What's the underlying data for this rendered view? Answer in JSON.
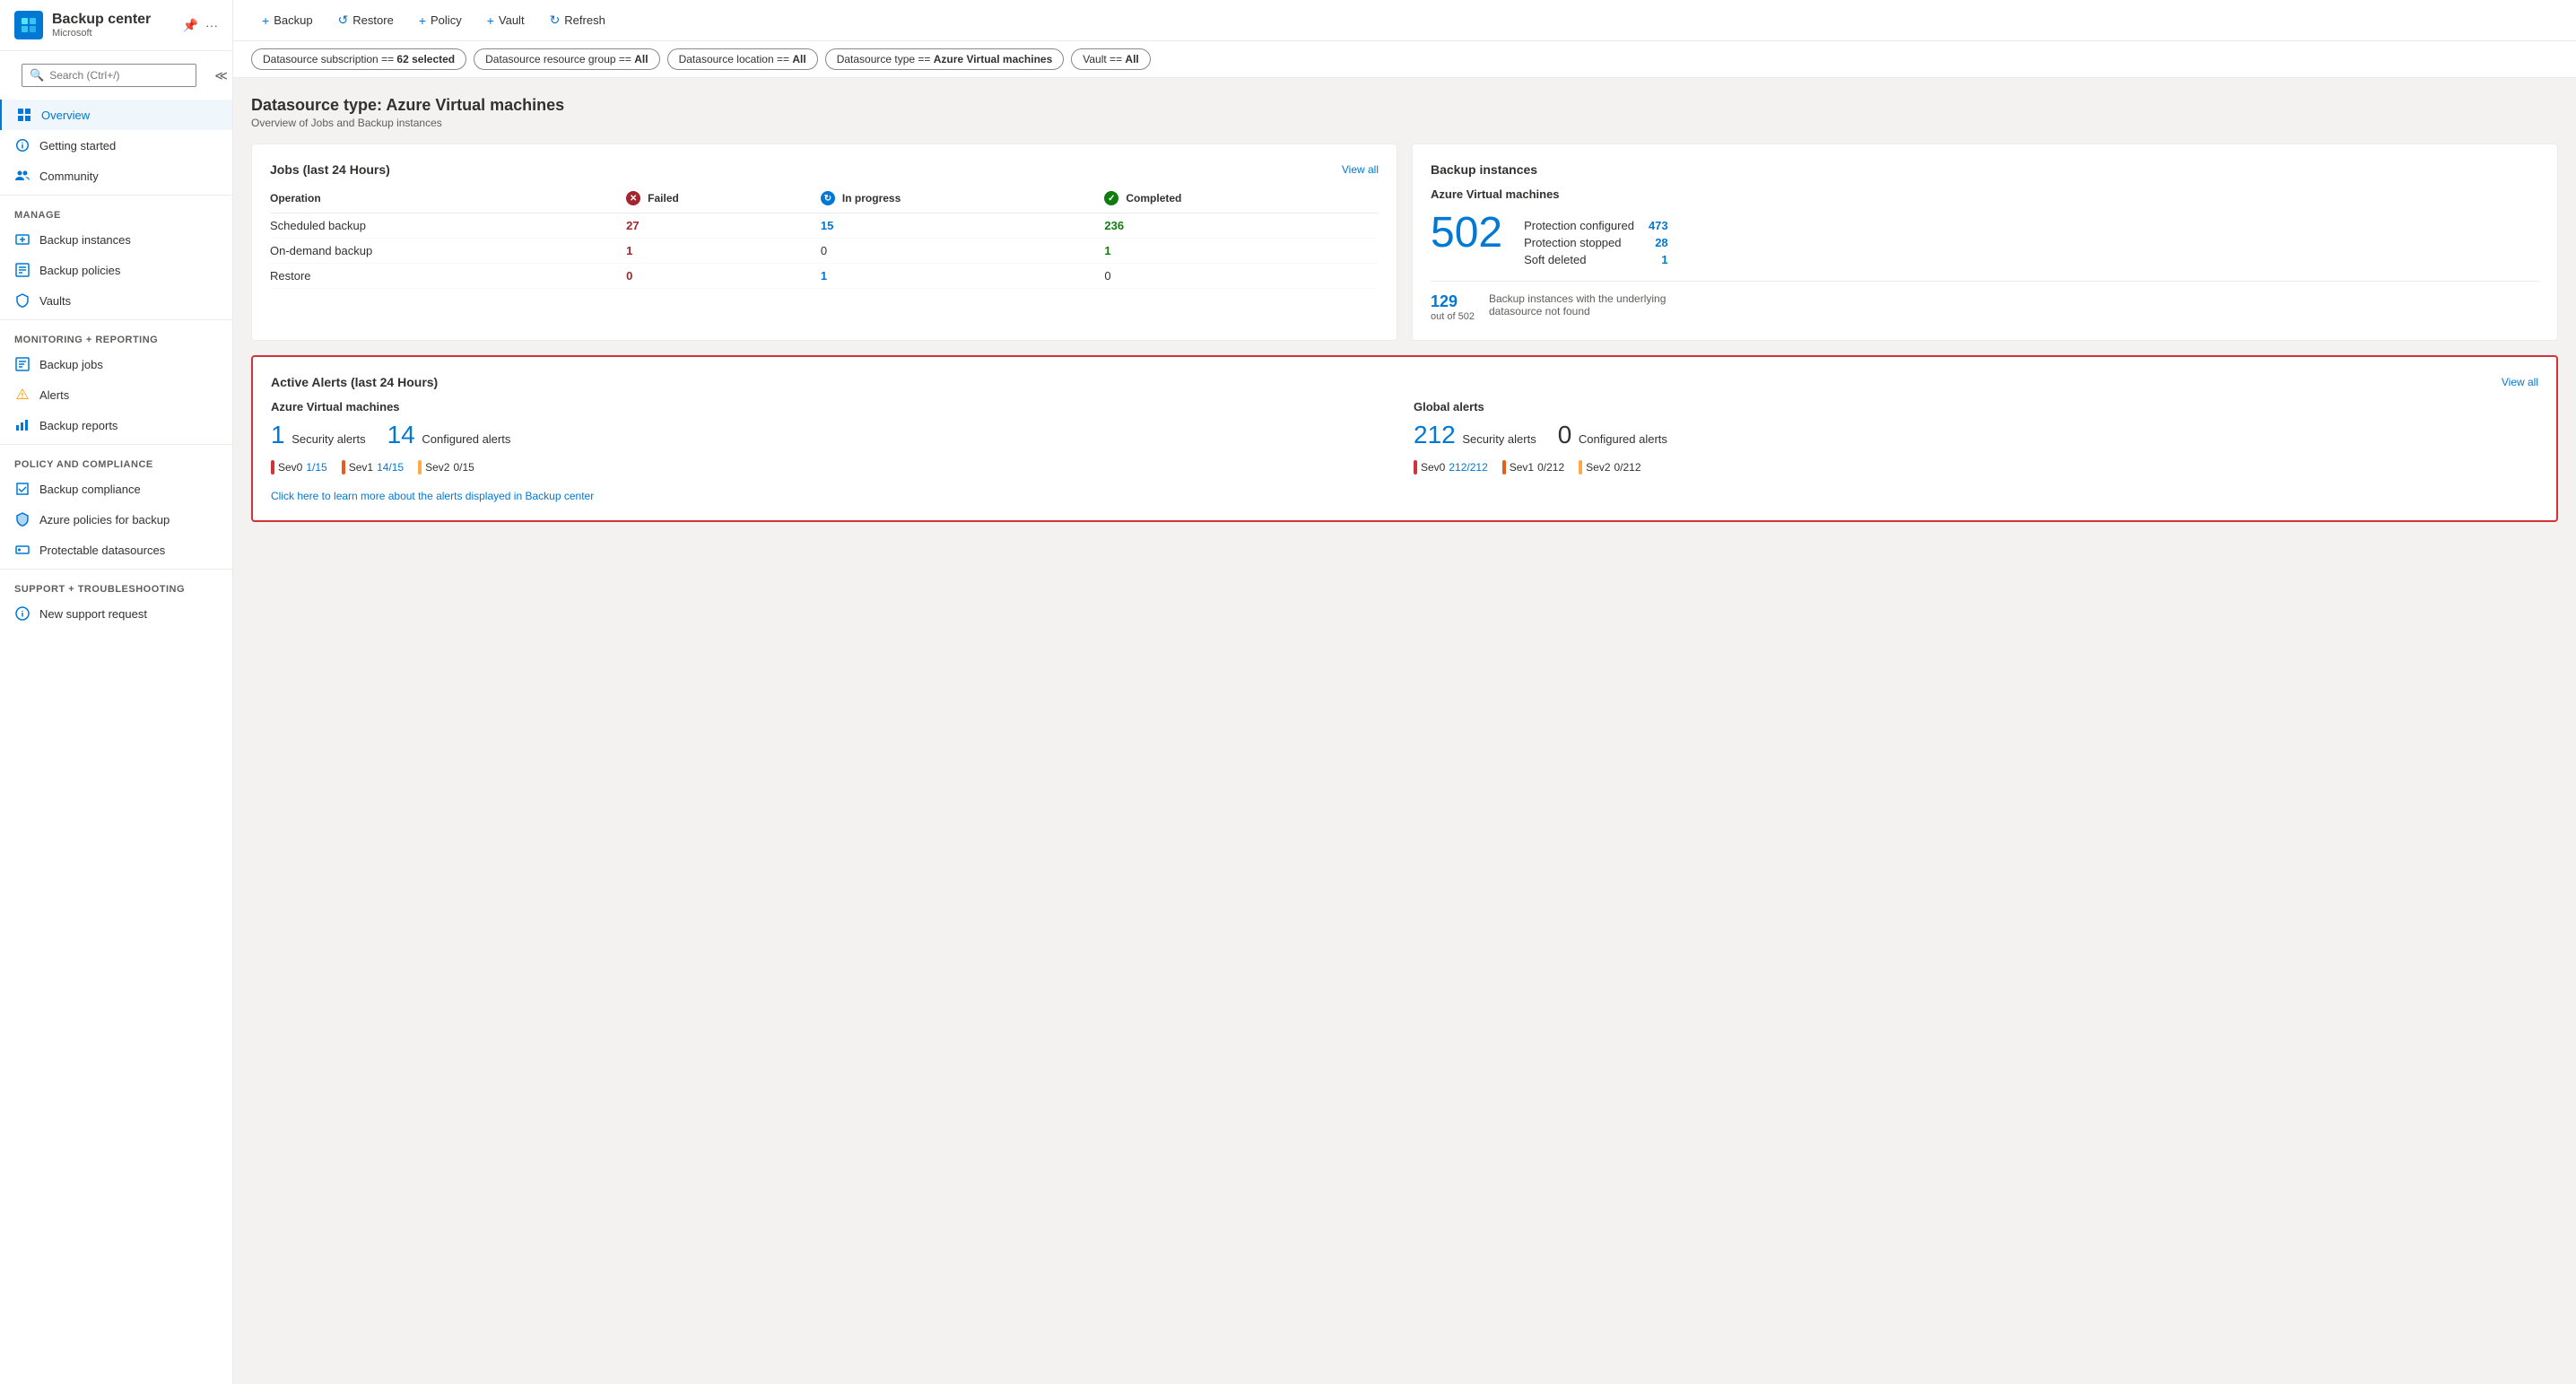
{
  "app": {
    "title": "Backup center",
    "subtitle": "Microsoft"
  },
  "sidebar": {
    "search_placeholder": "Search (Ctrl+/)",
    "nav_items": [
      {
        "id": "overview",
        "label": "Overview",
        "active": true,
        "icon": "overview"
      },
      {
        "id": "getting-started",
        "label": "Getting started",
        "active": false,
        "icon": "getting-started"
      },
      {
        "id": "community",
        "label": "Community",
        "active": false,
        "icon": "community"
      }
    ],
    "manage_section": "Manage",
    "manage_items": [
      {
        "id": "backup-instances",
        "label": "Backup instances",
        "icon": "backup-instances"
      },
      {
        "id": "backup-policies",
        "label": "Backup policies",
        "icon": "backup-policies"
      },
      {
        "id": "vaults",
        "label": "Vaults",
        "icon": "vaults"
      }
    ],
    "monitoring_section": "Monitoring + reporting",
    "monitoring_items": [
      {
        "id": "backup-jobs",
        "label": "Backup jobs",
        "icon": "backup-jobs"
      },
      {
        "id": "alerts",
        "label": "Alerts",
        "icon": "alerts"
      },
      {
        "id": "backup-reports",
        "label": "Backup reports",
        "icon": "backup-reports"
      }
    ],
    "policy_section": "Policy and compliance",
    "policy_items": [
      {
        "id": "backup-compliance",
        "label": "Backup compliance",
        "icon": "backup-compliance"
      },
      {
        "id": "azure-policies",
        "label": "Azure policies for backup",
        "icon": "azure-policies"
      },
      {
        "id": "protectable-datasources",
        "label": "Protectable datasources",
        "icon": "protectable-datasources"
      }
    ],
    "support_section": "Support + troubleshooting",
    "support_items": [
      {
        "id": "new-support-request",
        "label": "New support request",
        "icon": "support"
      }
    ]
  },
  "toolbar": {
    "buttons": [
      {
        "id": "backup",
        "label": "Backup",
        "icon": "+"
      },
      {
        "id": "restore",
        "label": "Restore",
        "icon": "↺"
      },
      {
        "id": "policy",
        "label": "Policy",
        "icon": "+"
      },
      {
        "id": "vault",
        "label": "Vault",
        "icon": "+"
      },
      {
        "id": "refresh",
        "label": "Refresh",
        "icon": "↻"
      }
    ]
  },
  "filters": [
    {
      "id": "subscription",
      "text": "Datasource subscription == ",
      "bold": "62 selected"
    },
    {
      "id": "resource-group",
      "text": "Datasource resource group == ",
      "bold": "All"
    },
    {
      "id": "location",
      "text": "Datasource location == ",
      "bold": "All"
    },
    {
      "id": "datasource-type",
      "text": "Datasource type == ",
      "bold": "Azure Virtual machines"
    },
    {
      "id": "vault",
      "text": "Vault == ",
      "bold": "All"
    }
  ],
  "page": {
    "title": "Datasource type: Azure Virtual machines",
    "subtitle": "Overview of Jobs and Backup instances"
  },
  "jobs_card": {
    "title": "Jobs (last 24 Hours)",
    "view_all": "View all",
    "headers": [
      "Operation",
      "Failed",
      "In progress",
      "Completed"
    ],
    "rows": [
      {
        "operation": "Scheduled backup",
        "failed": "27",
        "in_progress": "15",
        "completed": "236"
      },
      {
        "operation": "On-demand backup",
        "failed": "1",
        "in_progress": "0",
        "completed": "1"
      },
      {
        "operation": "Restore",
        "failed": "0",
        "in_progress": "1",
        "completed": "0"
      }
    ]
  },
  "backup_instances_card": {
    "title": "Backup instances",
    "vm_title": "Azure Virtual machines",
    "total": "502",
    "protection_configured_label": "Protection configured",
    "protection_configured_value": "473",
    "protection_stopped_label": "Protection stopped",
    "protection_stopped_value": "28",
    "soft_deleted_label": "Soft deleted",
    "soft_deleted_value": "1",
    "bottom_num": "129",
    "bottom_outof": "out of 502",
    "bottom_label": "Backup instances with the underlying datasource not found"
  },
  "alerts_card": {
    "title": "Active Alerts (last 24 Hours)",
    "view_all": "View all",
    "azure_section_title": "Azure Virtual machines",
    "azure_security_count": "1",
    "azure_security_label": "Security alerts",
    "azure_configured_count": "14",
    "azure_configured_label": "Configured alerts",
    "azure_sev": [
      {
        "level": "Sev0",
        "color": "red",
        "value": "1/15",
        "colored": true
      },
      {
        "level": "Sev1",
        "color": "orange",
        "value": "14/15",
        "colored": true
      },
      {
        "level": "Sev2",
        "color": "yellow",
        "value": "0/15",
        "colored": false
      }
    ],
    "global_section_title": "Global alerts",
    "global_security_count": "212",
    "global_security_label": "Security alerts",
    "global_configured_count": "0",
    "global_configured_label": "Configured alerts",
    "global_sev": [
      {
        "level": "Sev0",
        "color": "red",
        "value": "212/212",
        "colored": true
      },
      {
        "level": "Sev1",
        "color": "orange",
        "value": "0/212",
        "colored": false
      },
      {
        "level": "Sev2",
        "color": "yellow",
        "value": "0/212",
        "colored": false
      }
    ],
    "learn_more_text": "Click here to learn more about the alerts displayed in Backup center"
  }
}
